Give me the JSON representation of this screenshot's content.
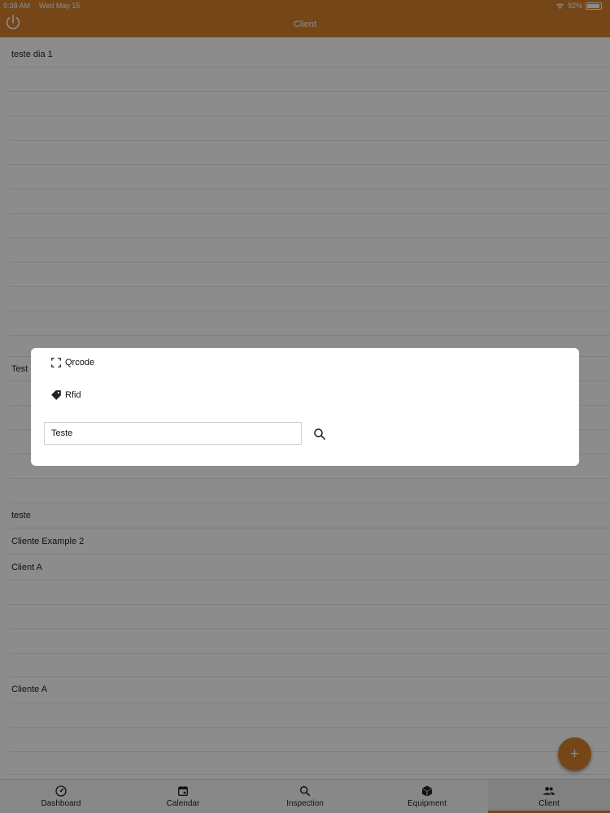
{
  "status_bar": {
    "time": "9:38 AM",
    "date": "Wed May 15",
    "battery": "92%"
  },
  "app_bar": {
    "title": "Client"
  },
  "clients": [
    {
      "name": "teste dia 1"
    },
    {
      "name": "Test"
    },
    {
      "name": "teste"
    },
    {
      "name": "Cliente Example 2"
    },
    {
      "name": "Client A"
    },
    {
      "name": "Cliente A"
    }
  ],
  "fab": {
    "label": "+"
  },
  "tabs": [
    {
      "label": "Dashboard",
      "icon": "dashboard-gauge-icon"
    },
    {
      "label": "Calendar",
      "icon": "calendar-icon"
    },
    {
      "label": "Inspection",
      "icon": "search-icon"
    },
    {
      "label": "Equipment",
      "icon": "cube-icon"
    },
    {
      "label": "Client",
      "icon": "people-icon",
      "active": true
    }
  ],
  "dialog": {
    "qrcode_label": "Qrcode",
    "rfid_label": "Rfid",
    "search_value": "Teste"
  },
  "colors": {
    "accent": "#d5822c",
    "overlay": "rgba(0,0,0,0.45)"
  }
}
